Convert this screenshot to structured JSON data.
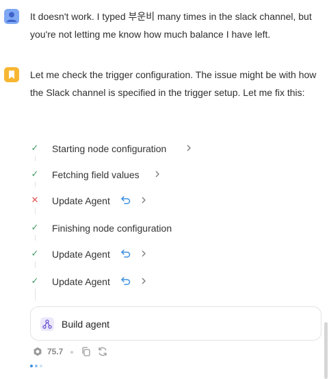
{
  "user_message": {
    "text": "It doesn't work. I typed 부운비 many times in the slack channel, but you're not letting me know how much balance I have left."
  },
  "assistant_message": {
    "text": "Let me check the trigger configuration. The issue might be with how the Slack channel is specified in the trigger setup. Let me fix this:"
  },
  "steps": [
    {
      "label": "Starting node configuration",
      "status": "success",
      "undo": false
    },
    {
      "label": "Fetching field values",
      "status": "success",
      "undo": false
    },
    {
      "label": "Update Agent",
      "status": "failed",
      "undo": true
    },
    {
      "label": "Finishing node configuration",
      "status": "success",
      "undo": false
    },
    {
      "label": "Update Agent",
      "status": "success",
      "undo": true
    },
    {
      "label": "Update Agent",
      "status": "success",
      "undo": true
    }
  ],
  "build": {
    "label": "Build agent"
  },
  "footer": {
    "credits": "75.7"
  },
  "colors": {
    "success": "#3f9a62",
    "failed": "#e05252",
    "undo": "#3b8fe0",
    "user_avatar": "#7ea8f4",
    "bot_avatar": "#f7b733"
  }
}
